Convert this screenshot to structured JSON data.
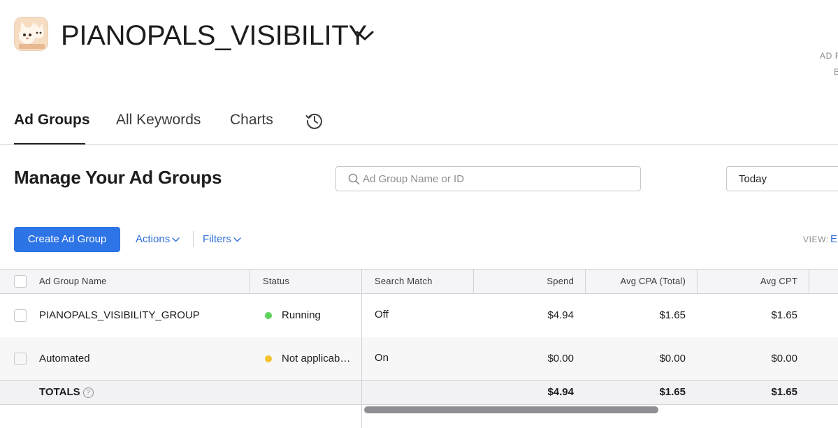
{
  "app": {
    "icon": "cat-app-icon",
    "title": "PIANOPALS_VISIBILITY",
    "corner_text_1": "AD F",
    "corner_text_2": "E"
  },
  "tabs": [
    {
      "label": "Ad Groups",
      "active": true
    },
    {
      "label": "All Keywords",
      "active": false
    },
    {
      "label": "Charts",
      "active": false
    }
  ],
  "history_icon": "history-icon",
  "section": {
    "title": "Manage Your Ad Groups"
  },
  "search": {
    "placeholder": "Ad Group Name or ID",
    "value": ""
  },
  "date_range": {
    "selected": "Today"
  },
  "toolbar": {
    "create_label": "Create Ad Group",
    "actions_label": "Actions",
    "filters_label": "Filters",
    "view_label": "VIEW:",
    "view_value": "Er"
  },
  "table": {
    "columns": [
      "Ad Group Name",
      "Status",
      "Search Match",
      "Spend",
      "Avg CPA (Total)",
      "Avg CPT"
    ],
    "rows": [
      {
        "name": "PIANOPALS_VISIBILITY_GROUP",
        "status": "Running",
        "status_color": "#5ed35c",
        "search_match": "Off",
        "spend": "$4.94",
        "avg_cpa": "$1.65",
        "avg_cpt": "$1.65"
      },
      {
        "name": "Automated",
        "status": "Not applicab…",
        "status_color": "#f5c32c",
        "search_match": "On",
        "spend": "$0.00",
        "avg_cpa": "$0.00",
        "avg_cpt": "$0.00"
      }
    ],
    "totals": {
      "label": "TOTALS",
      "help": "?",
      "spend": "$4.94",
      "avg_cpa": "$1.65",
      "avg_cpt": "$1.65"
    }
  },
  "colors": {
    "accent": "#2d74e6",
    "link": "#2e6fd6",
    "border": "#d2d2d7"
  }
}
